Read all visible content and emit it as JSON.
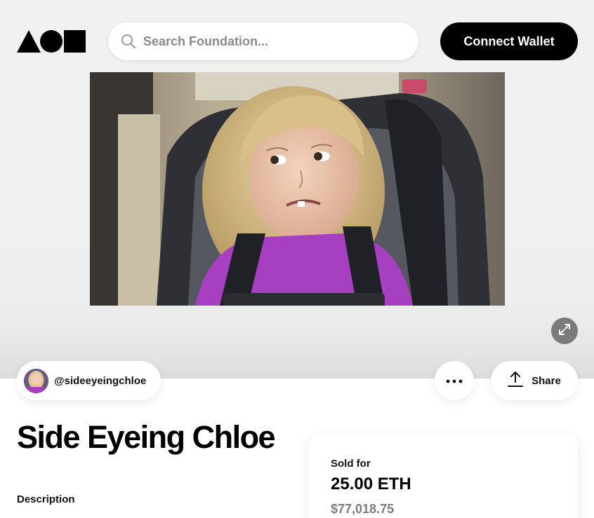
{
  "header": {
    "logo_icon": "foundation-logo-icon",
    "search_placeholder": "Search Foundation...",
    "connect_label": "Connect Wallet"
  },
  "artwork": {
    "media_icon": "artwork-image",
    "expand_icon": "expand-icon"
  },
  "creator": {
    "handle": "@sideeyeingchloe"
  },
  "actions": {
    "more_icon": "more-dots-icon",
    "share_label": "Share"
  },
  "nft": {
    "title": "Side Eyeing Chloe",
    "description_label": "Description"
  },
  "sale": {
    "label": "Sold for",
    "eth": "25.00 ETH",
    "usd": "$77,018.75"
  },
  "colors": {
    "accent": "#000000",
    "muted_text": "#7b7b7b",
    "shirt": "#a63fc0"
  }
}
